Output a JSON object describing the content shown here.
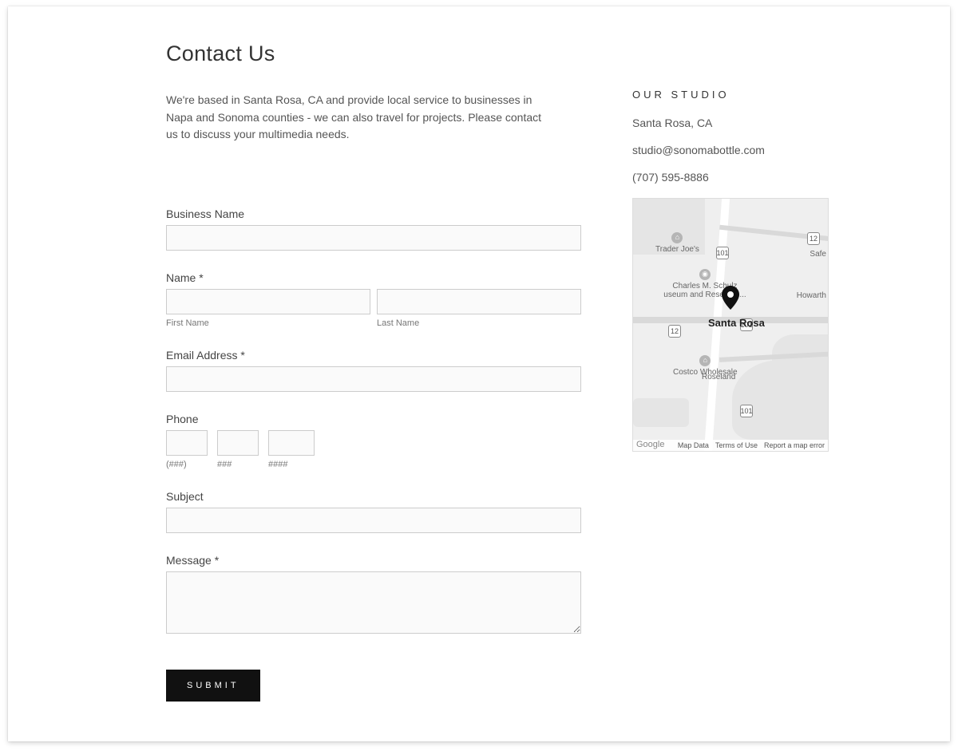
{
  "header": {
    "title": "Contact Us"
  },
  "intro": "We're based in Santa Rosa, CA and provide local service to businesses in Napa and Sonoma counties - we can also travel for projects.  Please contact us to discuss your multimedia needs.",
  "form": {
    "business_name_label": "Business Name",
    "name_label": "Name *",
    "first_name_sub": "First Name",
    "last_name_sub": "Last Name",
    "email_label": "Email Address *",
    "phone_label": "Phone",
    "phone_sub1": "(###)",
    "phone_sub2": "###",
    "phone_sub3": "####",
    "subject_label": "Subject",
    "message_label": "Message *",
    "submit_label": "SUBMIT"
  },
  "studio": {
    "heading": "OUR STUDIO",
    "city": "Santa Rosa, CA",
    "email": "studio@sonomabottle.com",
    "phone": "(707) 595-8886"
  },
  "map": {
    "center_label": "Santa Rosa",
    "pois": {
      "trader_joes": "Trader Joe's",
      "schulz": "Charles M. Schulz\nuseum and Research...",
      "costco": "Costco Wholesale",
      "roseland": "Roseland",
      "howarth": "Howarth",
      "safe": "Safe"
    },
    "shields": {
      "r101a": "101",
      "r101b": "101",
      "r101c": "101",
      "r12a": "12",
      "r12b": "12"
    },
    "footer": {
      "brand": "Google",
      "data": "Map Data",
      "terms": "Terms of Use",
      "report": "Report a map error"
    }
  }
}
